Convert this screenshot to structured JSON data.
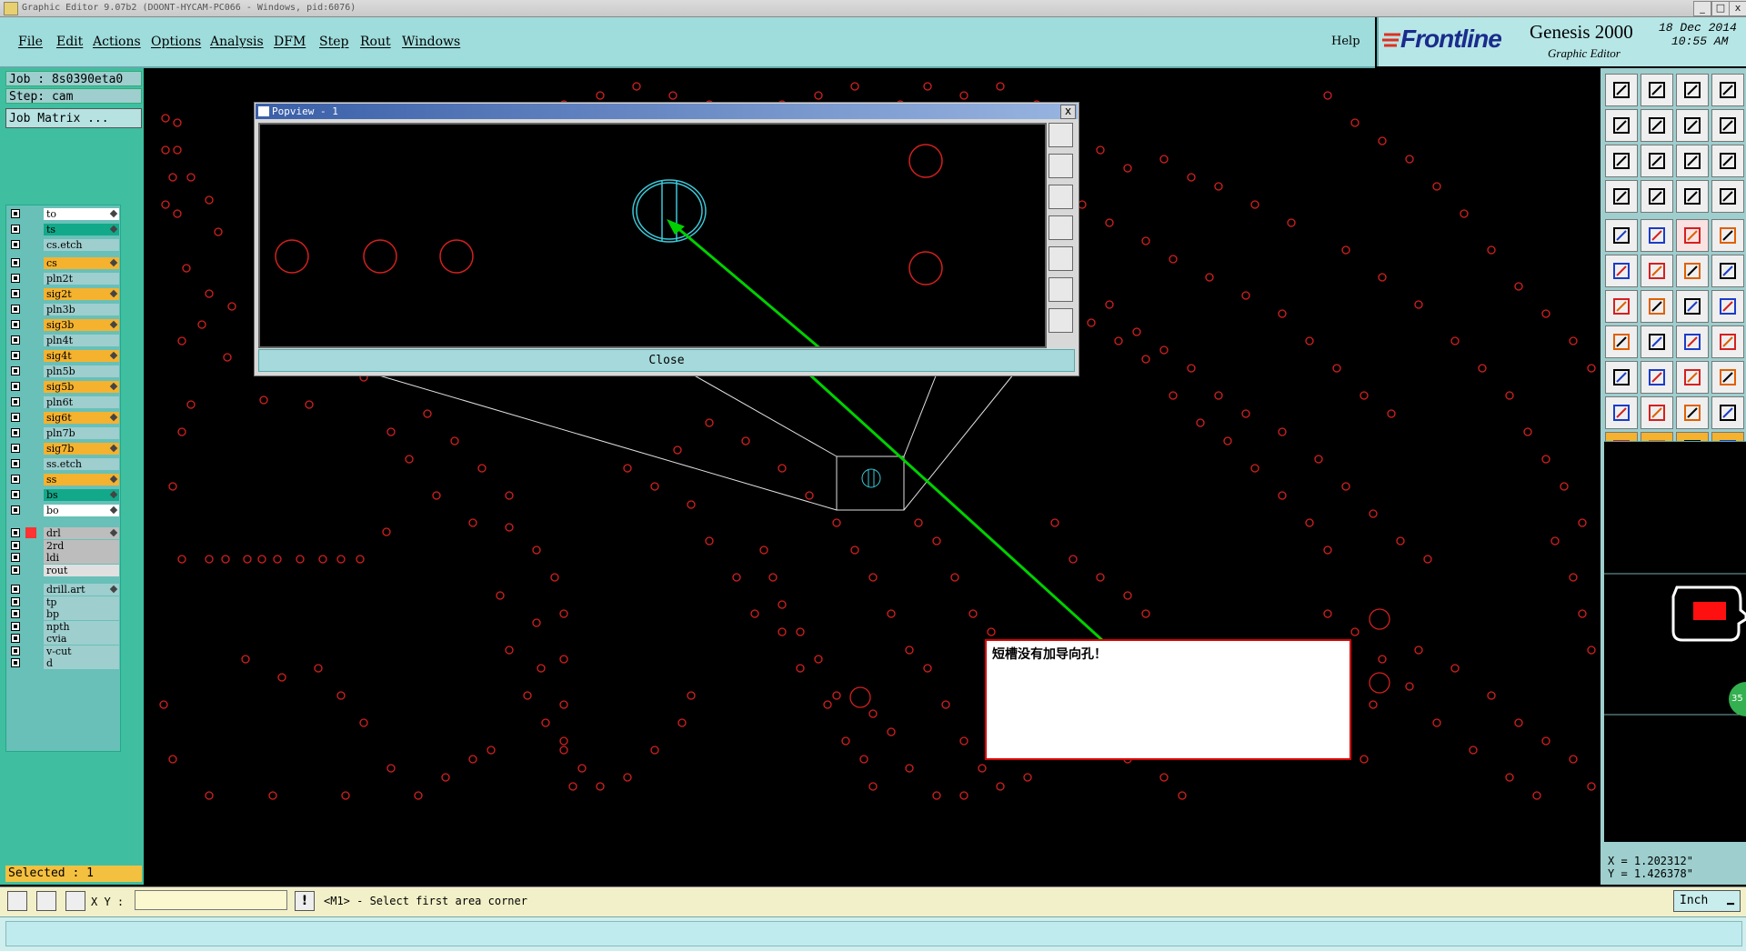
{
  "window": {
    "title": "Graphic Editor 9.07b2 (DOONT-HYCAM-PC066 - Windows, pid:6076)",
    "buttons": [
      "_",
      "□",
      "x"
    ]
  },
  "menu": {
    "items": [
      "File",
      "Edit",
      "Actions",
      "Options",
      "Analysis",
      "DFM",
      "Step",
      "Rout",
      "Windows"
    ],
    "help": "Help"
  },
  "brand": {
    "logo": "Frontline",
    "product": "Genesis 2000",
    "subtitle": "Graphic Editor",
    "date": "18 Dec 2014",
    "time": "10:55 AM"
  },
  "left_panel": {
    "job": "Job : 8s0390eta0",
    "step": "Step: cam",
    "job_matrix": "Job Matrix ...",
    "selected": "Selected : 1"
  },
  "layers": [
    {
      "name": "to",
      "color": "#ffffff",
      "flag": true
    },
    {
      "name": "ts",
      "color": "#12a98a",
      "flag": true
    },
    {
      "name": "cs.etch",
      "color": "#9ecece",
      "flag": false
    },
    {
      "name": "cs",
      "color": "#f5b22e",
      "flag": true
    },
    {
      "name": "pln2t",
      "color": "#9ecece",
      "flag": false
    },
    {
      "name": "sig2t",
      "color": "#f5b22e",
      "flag": true
    },
    {
      "name": "pln3b",
      "color": "#9ecece",
      "flag": false
    },
    {
      "name": "sig3b",
      "color": "#f5b22e",
      "flag": true
    },
    {
      "name": "pln4t",
      "color": "#9ecece",
      "flag": false
    },
    {
      "name": "sig4t",
      "color": "#f5b22e",
      "flag": true
    },
    {
      "name": "pln5b",
      "color": "#9ecece",
      "flag": false
    },
    {
      "name": "sig5b",
      "color": "#f5b22e",
      "flag": true
    },
    {
      "name": "pln6t",
      "color": "#9ecece",
      "flag": false
    },
    {
      "name": "sig6t",
      "color": "#f5b22e",
      "flag": true
    },
    {
      "name": "pln7b",
      "color": "#9ecece",
      "flag": false
    },
    {
      "name": "sig7b",
      "color": "#f5b22e",
      "flag": true
    },
    {
      "name": "ss.etch",
      "color": "#9ecece",
      "flag": false
    },
    {
      "name": "ss",
      "color": "#f5b22e",
      "flag": true
    },
    {
      "name": "bs",
      "color": "#12a98a",
      "flag": true
    },
    {
      "name": "bo",
      "color": "#ffffff",
      "flag": true
    },
    {
      "name": "drl",
      "color": "#bdbdbd",
      "flag": true
    },
    {
      "name": "2rd",
      "color": "#bdbdbd",
      "flag": false
    },
    {
      "name": "ldi",
      "color": "#bdbdbd",
      "flag": false
    },
    {
      "name": "rout",
      "color": "#e0e0e0",
      "flag": false
    },
    {
      "name": "drill.art",
      "color": "#9ecece",
      "flag": true
    },
    {
      "name": "tp",
      "color": "#9ecece",
      "flag": false
    },
    {
      "name": "bp",
      "color": "#9ecece",
      "flag": false
    },
    {
      "name": "npth",
      "color": "#9ecece",
      "flag": false
    },
    {
      "name": "cvia",
      "color": "#9ecece",
      "flag": false
    },
    {
      "name": "v-cut",
      "color": "#9ecece",
      "flag": false
    },
    {
      "name": "d",
      "color": "#9ecece",
      "flag": false
    }
  ],
  "popview": {
    "title": "Popview - 1",
    "close_label": "Close",
    "close_x": "x"
  },
  "message": {
    "text": "短槽没有加导向孔！"
  },
  "status": {
    "xy_label": "X Y :",
    "xy_value": "",
    "prompt": "<M1> - Select first area corner",
    "units": "Inch",
    "units_arrow": "▁"
  },
  "coords": {
    "x": "X = 1.202312\"",
    "y": "Y = 1.426378\""
  },
  "overview_badge": "35",
  "colors": {
    "menu_bg": "#9fdcdc",
    "panel_bg": "#3fbfa0",
    "canvas_bg": "#000000",
    "pad_red": "#d42020",
    "feature_cyan": "#3cc8d8",
    "annotation_green": "#00d000",
    "highlight_orange": "#f5b22e"
  }
}
